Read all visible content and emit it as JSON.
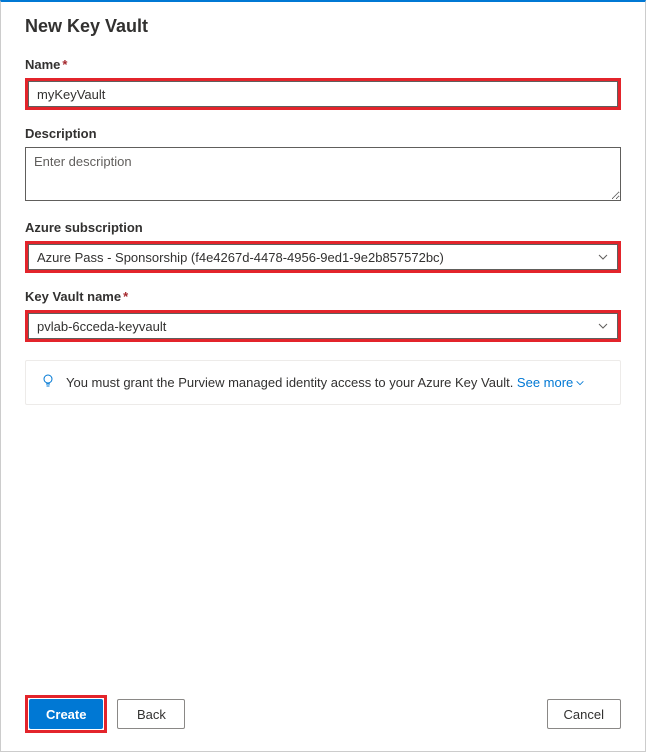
{
  "dialog": {
    "title": "New Key Vault"
  },
  "fields": {
    "name": {
      "label": "Name",
      "value": "myKeyVault",
      "required": "*"
    },
    "description": {
      "label": "Description",
      "placeholder": "Enter description",
      "value": ""
    },
    "subscription": {
      "label": "Azure subscription",
      "selected": "Azure Pass - Sponsorship (f4e4267d-4478-4956-9ed1-9e2b857572bc)"
    },
    "keyvault": {
      "label": "Key Vault name",
      "required": "*",
      "selected": "pvlab-6cceda-keyvault"
    }
  },
  "info": {
    "text": "You must grant the Purview managed identity access to your Azure Key Vault. ",
    "see_more": "See more"
  },
  "buttons": {
    "create": "Create",
    "back": "Back",
    "cancel": "Cancel"
  }
}
